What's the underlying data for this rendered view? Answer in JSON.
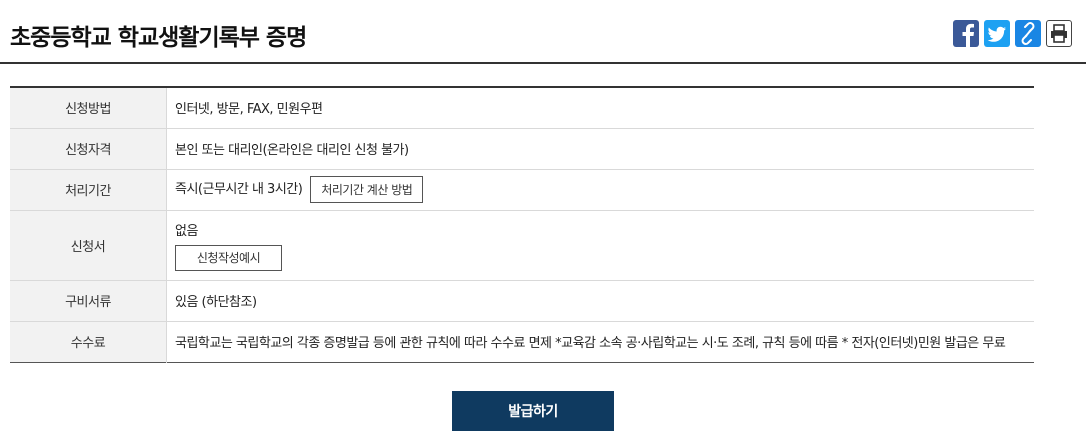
{
  "header": {
    "title": "초중등학교 학교생활기록부 증명",
    "share": {
      "facebook_icon": "facebook-icon",
      "twitter_icon": "twitter-icon",
      "link_icon": "link-icon",
      "print_icon": "print-icon"
    }
  },
  "rows": [
    {
      "label": "신청방법",
      "value": "인터넷, 방문, FAX, 민원우편"
    },
    {
      "label": "신청자격",
      "value": "본인 또는 대리인(온라인은 대리인 신청 불가)"
    },
    {
      "label": "처리기간",
      "value": "즉시(근무시간 내 3시간)",
      "button": "처리기간 계산 방법"
    },
    {
      "label": "신청서",
      "value": "없음",
      "button": "신청작성예시"
    },
    {
      "label": "구비서류",
      "value": "있음 (하단참조)"
    },
    {
      "label": "수수료",
      "value": "국립학교는 국립학교의 각종 증명발급 등에 관한 규칙에 따라 수수료 면제 *교육감 소속 공·사립학교는 시·도 조례, 규칙 등에 따름 * 전자(인터넷)민원 발급은 무료"
    }
  ],
  "issue_button": "발급하기",
  "colors": {
    "primary_button": "#0f3a60",
    "facebook": "#3b5998",
    "twitter": "#1da1f2",
    "link": "#1a86e4",
    "header_cell_bg": "#f2f2f2"
  }
}
